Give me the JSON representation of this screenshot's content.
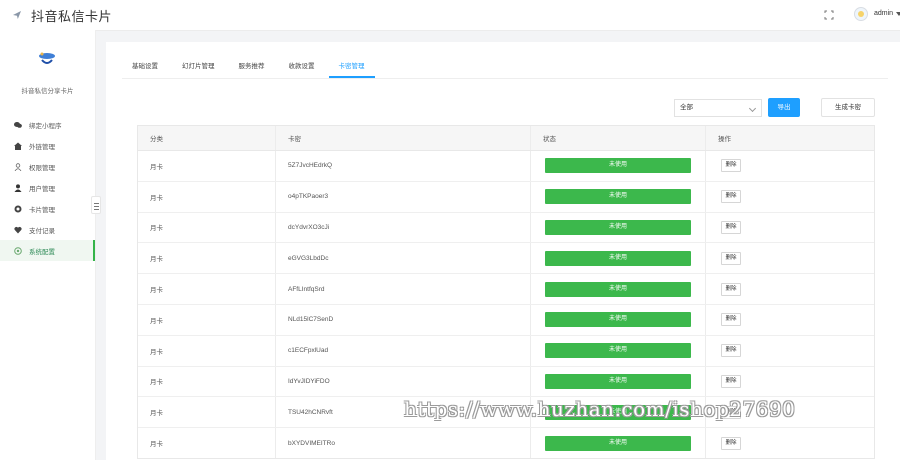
{
  "header": {
    "title": "抖音私信卡片",
    "user_name": "admin",
    "brand_icon": "paper-plane-icon",
    "fullscreen_icon": "fullscreen-icon"
  },
  "sidebar": {
    "app_name": "抖音私信分享卡片",
    "items": [
      {
        "label": "绑定小程序",
        "icon": "chat-icon",
        "active": false
      },
      {
        "label": "外链管理",
        "icon": "home-icon",
        "active": false
      },
      {
        "label": "权限管理",
        "icon": "user-outline-icon",
        "active": false
      },
      {
        "label": "用户管理",
        "icon": "user-icon",
        "active": false
      },
      {
        "label": "卡片管理",
        "icon": "card-icon",
        "active": false
      },
      {
        "label": "支付记录",
        "icon": "heart-icon",
        "active": false
      },
      {
        "label": "系统配置",
        "icon": "settings-icon",
        "active": true
      }
    ]
  },
  "tabs": [
    {
      "label": "基础设置",
      "active": false
    },
    {
      "label": "幻灯片管理",
      "active": false
    },
    {
      "label": "服务推荐",
      "active": false
    },
    {
      "label": "收款设置",
      "active": false
    },
    {
      "label": "卡密管理",
      "active": true
    }
  ],
  "filter": {
    "selected": "全部"
  },
  "buttons": {
    "export": "导出",
    "generate": "生成卡密"
  },
  "table": {
    "columns": [
      "分类",
      "卡密",
      "状态",
      "操作"
    ],
    "rows": [
      {
        "type": "月卡",
        "code": "5Z7JvcHEdrkQ",
        "status": "未使用",
        "action": "删除"
      },
      {
        "type": "月卡",
        "code": "o4pTKPaoer3",
        "status": "未使用",
        "action": "删除"
      },
      {
        "type": "月卡",
        "code": "dcYdvrXO3cJi",
        "status": "未使用",
        "action": "删除"
      },
      {
        "type": "月卡",
        "code": "eGVG3LbdDc",
        "status": "未使用",
        "action": "删除"
      },
      {
        "type": "月卡",
        "code": "AFfLIntfqSrd",
        "status": "未使用",
        "action": "删除"
      },
      {
        "type": "月卡",
        "code": "NLd15lC7SenD",
        "status": "未使用",
        "action": "删除"
      },
      {
        "type": "月卡",
        "code": "c1ECFpxlUad",
        "status": "未使用",
        "action": "删除"
      },
      {
        "type": "月卡",
        "code": "IdYvJIDYiFDO",
        "status": "未使用",
        "action": "删除"
      },
      {
        "type": "月卡",
        "code": "TSU42hCNRvft",
        "status": "未使用",
        "action": "删除"
      },
      {
        "type": "月卡",
        "code": "bXYDVIMEITRo",
        "status": "未使用",
        "action": "删除"
      }
    ]
  },
  "watermark": "https://www.huzhan.com/ishop27690",
  "colors": {
    "accent": "#1e9fff",
    "status_green": "#3cb84c",
    "active_menu": "#35b34a"
  }
}
